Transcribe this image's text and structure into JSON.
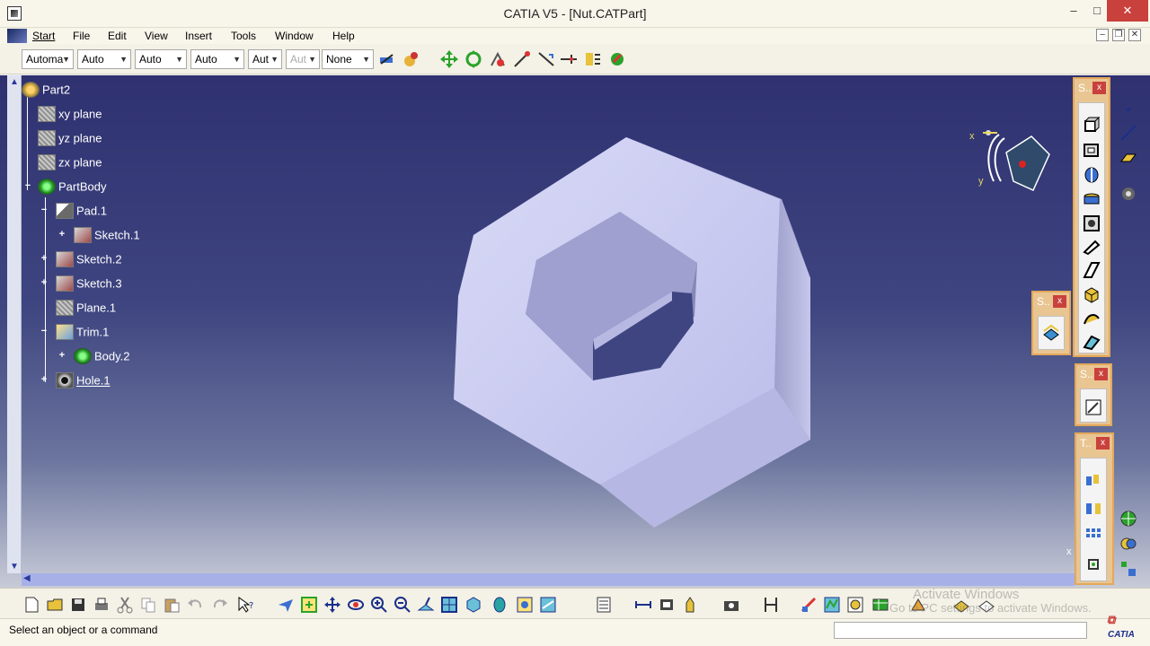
{
  "window": {
    "title": "CATIA V5 - [Nut.CATPart]",
    "minimize": "–",
    "maximize": "□",
    "close": "✕"
  },
  "menu": {
    "items": [
      "Start",
      "File",
      "Edit",
      "View",
      "Insert",
      "Tools",
      "Window",
      "Help"
    ],
    "mdi_minimize": "–",
    "mdi_restore": "❐",
    "mdi_close": "✕"
  },
  "toolbar": {
    "combos": [
      "Automa",
      "Auto",
      "Auto",
      "Auto",
      "Aut",
      "Aut",
      "None"
    ],
    "icons": [
      "apply-material-icon",
      "render-style-icon",
      "pan-icon",
      "rotate-icon",
      "measure-icon",
      "snap-icon",
      "analysis-icon",
      "dress-up-icon",
      "tag-icon",
      "check-icon"
    ]
  },
  "tree": {
    "nodes": [
      {
        "label": "Part2",
        "icon": "part-icon"
      },
      {
        "label": "xy plane",
        "icon": "plane-icon"
      },
      {
        "label": "yz plane",
        "icon": "plane-icon"
      },
      {
        "label": "zx plane",
        "icon": "plane-icon"
      },
      {
        "label": "PartBody",
        "icon": "body-icon"
      },
      {
        "label": "Pad.1",
        "icon": "pad-icon"
      },
      {
        "label": "Sketch.1",
        "icon": "sketch-icon"
      },
      {
        "label": "Sketch.2",
        "icon": "sketch-icon"
      },
      {
        "label": "Sketch.3",
        "icon": "sketch-icon"
      },
      {
        "label": "Plane.1",
        "icon": "plane-icon"
      },
      {
        "label": "Trim.1",
        "icon": "trim-icon"
      },
      {
        "label": "Body.2",
        "icon": "body-icon"
      },
      {
        "label": "Hole.1",
        "icon": "hole-icon"
      }
    ]
  },
  "compass": {
    "x_label": "x",
    "y_label": "y"
  },
  "panels": {
    "sketch_based": {
      "title": "S..",
      "close": "x"
    },
    "surface": {
      "title": "S..",
      "close": "x"
    },
    "sketcher": {
      "title": "S..",
      "close": "x"
    },
    "transform": {
      "title": "T..",
      "close": "x"
    },
    "tiny_x": "x"
  },
  "bottom": {
    "watermark_line1": "Activate Windows",
    "watermark_line2": "Go to PC settings to activate Windows."
  },
  "status": {
    "text": "Select an object or a command",
    "brand": "CATIA"
  },
  "colors": {
    "viewport_top": "#2f3170",
    "part": "#c8c9f0",
    "panel": "#e9c592",
    "close": "#c9413c"
  }
}
